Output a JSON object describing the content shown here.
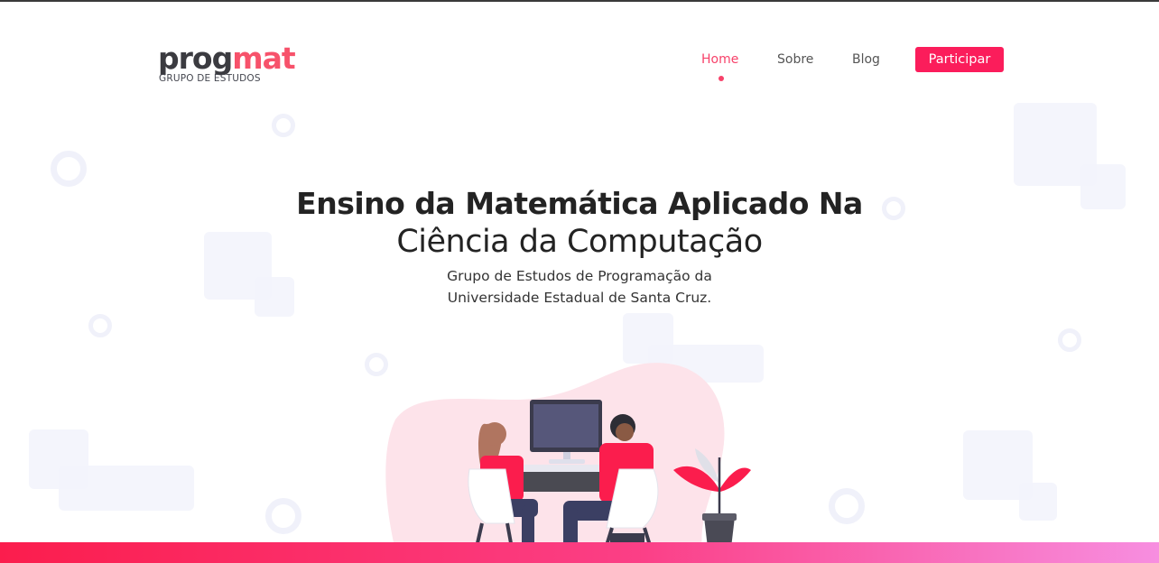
{
  "logo": {
    "part1": "prog",
    "part2": "mat",
    "subtitle": "GRUPO DE ESTUDOS"
  },
  "nav": {
    "items": [
      {
        "label": "Home",
        "active": true
      },
      {
        "label": "Sobre",
        "active": false
      },
      {
        "label": "Blog",
        "active": false
      }
    ],
    "cta_label": "Participar"
  },
  "hero": {
    "title_line1": "Ensino da Matemática Aplicado Na",
    "title_line2": "Ciência da Computação",
    "subtitle_line1": "Grupo de Estudos de Programação da",
    "subtitle_line2": "Universidade Estadual de Santa Cruz."
  },
  "colors": {
    "accent": "#fb1d5b",
    "nav_active": "#f7426a",
    "logo_dark": "#3b3b40",
    "logo_accent": "#f7526b"
  },
  "illustration": "two-people-at-computer-illustration"
}
